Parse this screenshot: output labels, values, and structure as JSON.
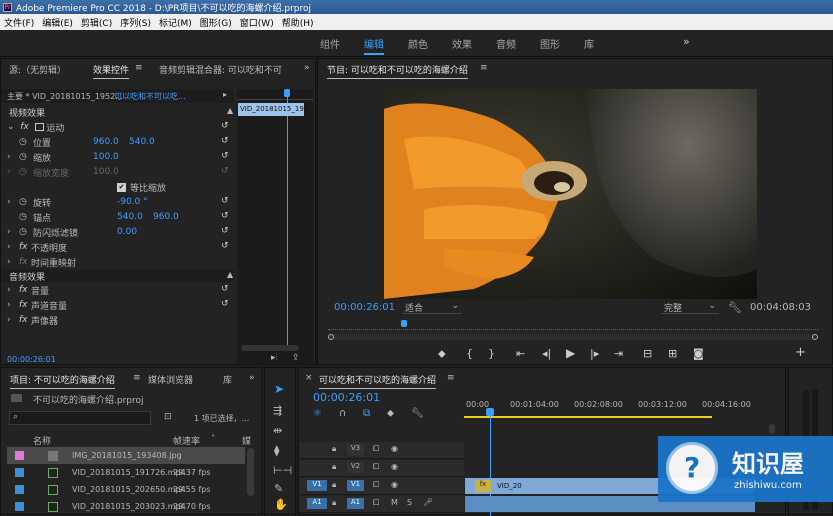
{
  "window": {
    "title": "Adobe Premiere Pro CC 2018 - D:\\PR项目\\不可以吃的海螺介绍.prproj"
  },
  "menu": [
    "文件(F)",
    "编辑(E)",
    "剪辑(C)",
    "序列(S)",
    "标记(M)",
    "图形(G)",
    "窗口(W)",
    "帮助(H)"
  ],
  "workspaces": {
    "tabs": [
      "组件",
      "编辑",
      "颜色",
      "效果",
      "音频",
      "图形",
      "库"
    ],
    "active": "编辑",
    "more": "»"
  },
  "effect_panel": {
    "tabs": [
      "源:（无剪辑）",
      "效果控件",
      "音频剪辑混合器: 可以吃和不可"
    ],
    "master": "主要 * VID_20181015_1952...",
    "sequence": "可以吃和不可以吃...",
    "clip_chip": "VID_20181015_195",
    "video_section": "视频效果",
    "motion": "运动",
    "position": {
      "label": "位置",
      "x": "960.0",
      "y": "540.0"
    },
    "scale": {
      "label": "缩放",
      "value": "100.0"
    },
    "scale_width": {
      "label": "缩放宽度",
      "value": "100.0"
    },
    "uniform": "等比缩放",
    "rotation": {
      "label": "旋转",
      "value": "-90.0 °"
    },
    "anchor": {
      "label": "锚点",
      "x": "540.0",
      "y": "960.0"
    },
    "flicker": {
      "label": "防闪烁滤镜",
      "value": "0.00"
    },
    "opacity": "不透明度",
    "time_remap": "时间重映射",
    "audio_section": "音频效果",
    "volume": "音量",
    "channel_volume": "声道音量",
    "panner": "声像器",
    "timecode": "00:00:26:01"
  },
  "program": {
    "title": "节目: 可以吃和不可以吃的海螺介绍",
    "timecode": "00:00:26:01",
    "fit": "适合",
    "quality": "完整",
    "duration": "00:04:08:03",
    "playhead_fraction": 0.155
  },
  "project": {
    "tabs": [
      "项目: 不可以吃的海螺介绍",
      "媒体浏览器",
      "库"
    ],
    "file": "不可以吃的海螺介绍.prproj",
    "selection": "1 项已选择，...",
    "col_name": "名称",
    "col_rate": "帧速率",
    "col_more": "媒",
    "items": [
      {
        "name": "IMG_20181015_193408.jpg",
        "rate": "",
        "color": "#e07ad8",
        "type": "image"
      },
      {
        "name": "VID_20181015_191726.mp4",
        "rate": "29.37 fps",
        "color": "#3e8fd6",
        "type": "video"
      },
      {
        "name": "VID_20181015_202650.mp4",
        "rate": "29.55 fps",
        "color": "#3e8fd6",
        "type": "video"
      },
      {
        "name": "VID_20181015_203023.mp4",
        "rate": "29.70 fps",
        "color": "#3e8fd6",
        "type": "video"
      }
    ]
  },
  "timeline": {
    "title": "可以吃和不可以吃的海螺介绍",
    "timecode": "00:00:26:01",
    "ruler": [
      "00:00",
      "00:01:04:00",
      "00:02:08:00",
      "00:03:12:00",
      "00:04:16:00"
    ],
    "tracks": [
      "V3",
      "V2",
      "V1",
      "A1"
    ],
    "source_v": "V1",
    "source_a": "A1",
    "clip_label": "VID_20"
  },
  "watermark": {
    "text": "知识屋",
    "url": "zhishiwu.com"
  }
}
